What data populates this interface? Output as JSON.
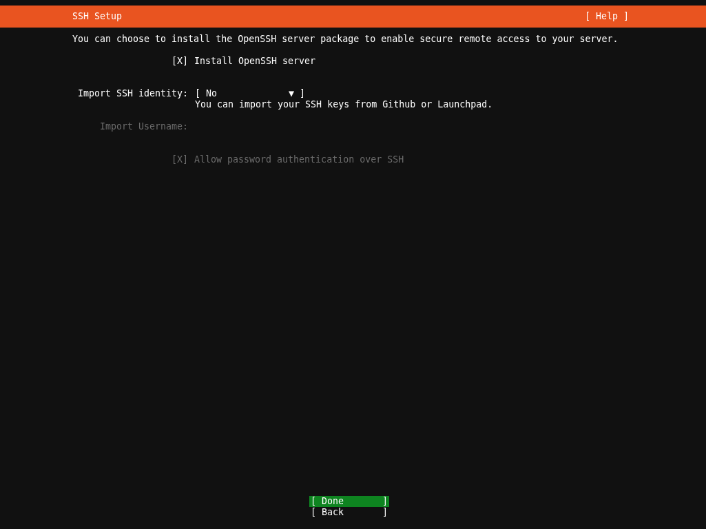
{
  "header": {
    "title": "SSH Setup",
    "help": "[ Help ]"
  },
  "description": "You can choose to install the OpenSSH server package to enable secure remote access to your server.",
  "fields": [
    {
      "kind": "checkbox",
      "mark": "[X]",
      "label": "Install OpenSSH server",
      "disabled": false
    },
    {
      "kind": "dropdown",
      "label": "Import SSH identity:",
      "value": "[ No             ▼ ]",
      "hint": "You can import your SSH keys from Github or Launchpad.",
      "disabled": false
    },
    {
      "kind": "text",
      "label": "Import Username:",
      "disabled": true
    },
    {
      "kind": "checkbox",
      "mark": "[X]",
      "label": "Allow password authentication over SSH",
      "disabled": true
    }
  ],
  "buttons": [
    {
      "label": "[ Done       ]",
      "selected": true
    },
    {
      "label": "[ Back       ]",
      "selected": false
    }
  ]
}
